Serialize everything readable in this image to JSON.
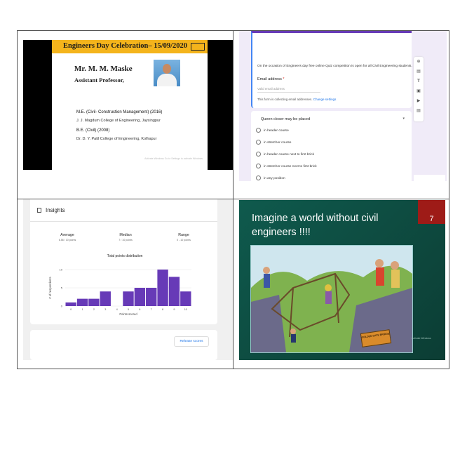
{
  "slide1": {
    "header": "Engineers Day Celebration– 15/09/2020",
    "name": "Mr. M. M. Maske",
    "role": "Assistant Professor,",
    "qualifications": [
      {
        "degree": "M.E. (Civil- Construction Management) (2016)",
        "college": "J. J. Magdum College of Engineering, Jaysingpur"
      },
      {
        "degree": "B.E. (Civil) (2008)",
        "college": "Dr. D. Y. Patil College of Engineering, Kolhapur"
      }
    ],
    "watermark": "Activate Windows Go to Settings to activate Windows."
  },
  "form": {
    "intro": "On the occasion of Engineers day free online Quiz competition is open for all Civil Engineering students.",
    "email_label": "Email address",
    "required_mark": "*",
    "email_placeholder": "Valid email address",
    "collecting_note": "This form is collecting email addresses.",
    "change_settings": "Change settings",
    "question": "Queen closer may be placed",
    "options": [
      "in header course",
      "in stretcher course",
      "in header course next to first brick",
      "in stretcher course next to first brick",
      "in any position"
    ],
    "tool_icons": [
      "add-question-icon",
      "import-icon",
      "title-icon",
      "image-icon",
      "video-icon",
      "section-icon"
    ]
  },
  "insights": {
    "title": "Insights",
    "stats": [
      {
        "label": "Average",
        "value": "6.56 / 10 points"
      },
      {
        "label": "Median",
        "value": "7 / 10 points"
      },
      {
        "label": "Range",
        "value": "0 - 10 points"
      }
    ],
    "release_label": "Release scores",
    "chart_data": {
      "type": "bar",
      "title": "Total points distribution",
      "xlabel": "Points scored",
      "ylabel": "# of respondents",
      "categories": [
        "0",
        "1",
        "2",
        "3",
        "4",
        "5",
        "6",
        "7",
        "8",
        "9",
        "10"
      ],
      "values": [
        1,
        2,
        2,
        4,
        0,
        4,
        5,
        5,
        10,
        8,
        4
      ],
      "ylim": [
        0,
        10
      ],
      "yticks": [
        0,
        5,
        10
      ],
      "color": "#673ab7"
    }
  },
  "slide2": {
    "title": "Imagine a world without civil engineers !!!!",
    "slide_number": "7",
    "sign_text": "GOLDEN GATE BRIDGE",
    "watermark": "Activate Windows"
  }
}
